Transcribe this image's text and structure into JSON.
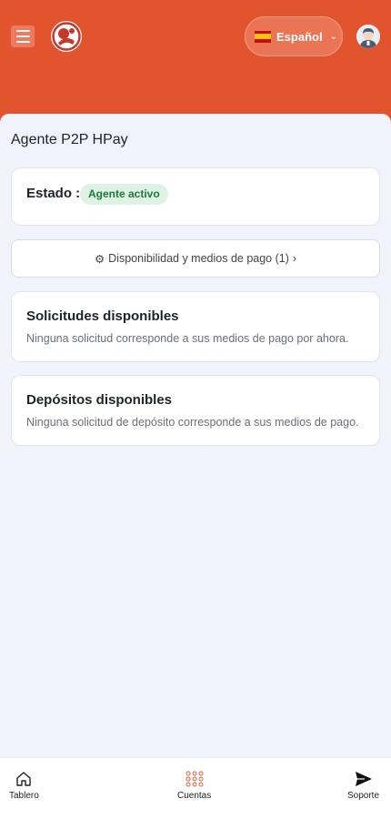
{
  "header": {
    "language_label": "Español",
    "brand_color": "#e2542e"
  },
  "main": {
    "title": "Agente P2P HPay",
    "status": {
      "label": "Estado :",
      "badge": "Agente activo"
    },
    "availability_button": {
      "icon": "gear-icon",
      "label": "Disponibilidad y medios de pago (1)",
      "chevron": "›"
    },
    "requests_card": {
      "title": "Solicitudes disponibles",
      "message": "Ninguna solicitud corresponde a sus medios de pago por ahora."
    },
    "deposits_card": {
      "title": "Depósitos disponibles",
      "message": "Ninguna solicitud de depósito corresponde a sus medios de pago."
    }
  },
  "bottom_nav": {
    "items": [
      {
        "label": "Tablero",
        "icon": "home-icon"
      },
      {
        "label": "Cuentas",
        "icon": "grid-icon"
      },
      {
        "label": "Soporte",
        "icon": "send-icon"
      }
    ]
  }
}
